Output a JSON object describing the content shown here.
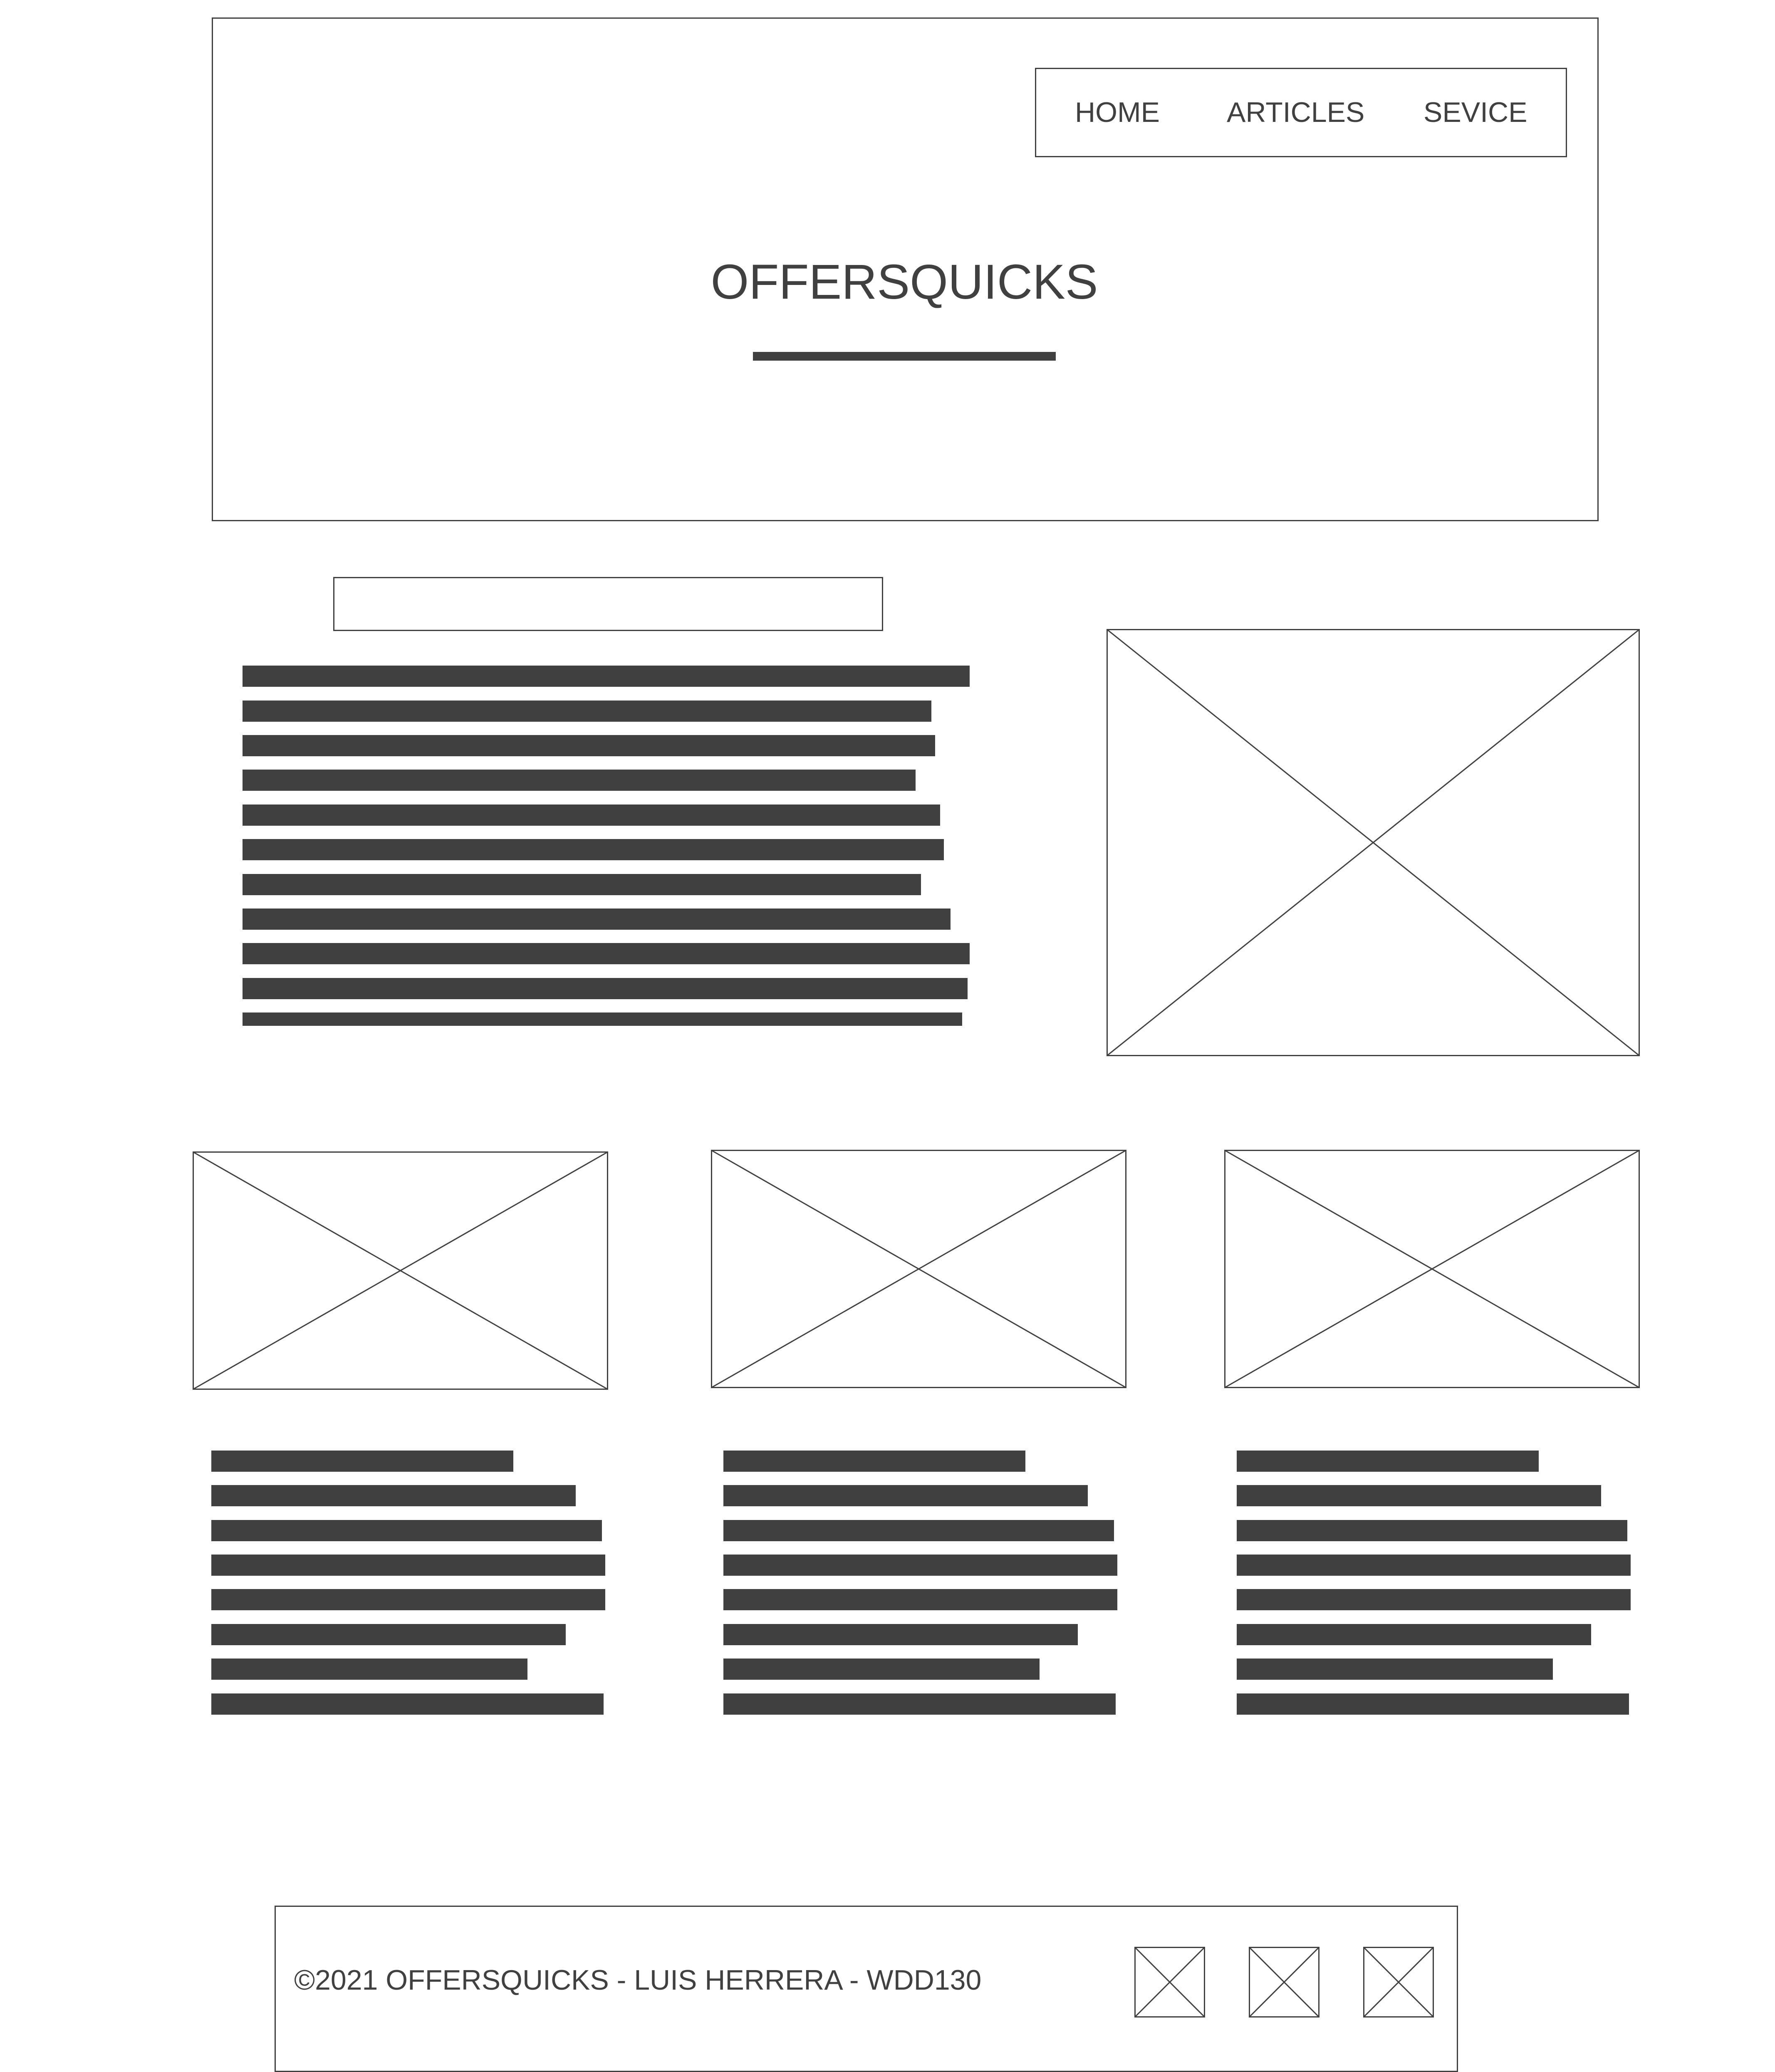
{
  "nav": {
    "items": [
      {
        "label": "HOME"
      },
      {
        "label": "ARTICLES"
      },
      {
        "label": "SEVICE"
      }
    ]
  },
  "hero": {
    "site_title": "OFFERSQUICKS"
  },
  "footer": {
    "copyright": "©2021 OFFERSQUICKS - LUIS HERRERA - WDD130"
  },
  "colors": {
    "ink": "#404040",
    "background": "#ffffff"
  },
  "icons": [
    "image-placeholder-icon",
    "social-icon"
  ]
}
